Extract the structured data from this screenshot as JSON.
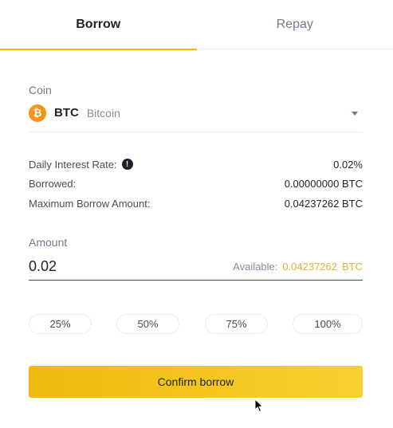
{
  "tabs": [
    {
      "label": "Borrow",
      "active": true
    },
    {
      "label": "Repay",
      "active": false
    }
  ],
  "coin": {
    "label": "Coin",
    "icon": "bitcoin-icon",
    "logo_glyph": "₿",
    "symbol": "BTC",
    "name": "Bitcoin"
  },
  "info": {
    "daily_interest_rate": {
      "label": "Daily Interest Rate:",
      "value": "0.02%"
    },
    "borrowed": {
      "label": "Borrowed:",
      "value": "0.00000000 BTC"
    },
    "max_borrow": {
      "label": "Maximum Borrow Amount:",
      "value": "0.04237262 BTC"
    }
  },
  "amount": {
    "label": "Amount",
    "value": "0.02",
    "available_label": "Available:",
    "available_amount": "0.04237262",
    "available_unit": "BTC"
  },
  "percent_buttons": [
    "25%",
    "50%",
    "75%",
    "100%"
  ],
  "confirm_label": "Confirm borrow",
  "colors": {
    "accent": "#f0b90b",
    "available_text": "#e0b43a",
    "bitcoin": "#f7931a"
  }
}
